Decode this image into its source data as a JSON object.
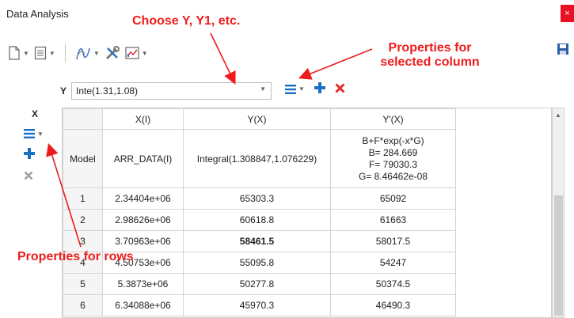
{
  "window": {
    "title": "Data Analysis",
    "close_glyph": "×"
  },
  "toolbar": {
    "buttons": [
      {
        "icon": "new-document-icon"
      },
      {
        "icon": "sheet-icon"
      },
      {
        "icon": "fit-curve-icon"
      },
      {
        "icon": "tools-icon"
      },
      {
        "icon": "chart-icon"
      }
    ],
    "save_icon": "save-icon"
  },
  "annotations": {
    "choose": "Choose Y, Y1, etc.",
    "props_column_line1": "Properties for",
    "props_column_line2": "selected column",
    "props_rows": "Properties for rows"
  },
  "y_selector": {
    "label": "Y",
    "value": "Inte(1.31,1.08)"
  },
  "x_label": "X",
  "table": {
    "columns": [
      "",
      "X(I)",
      "Y(X)",
      "Y'(X)"
    ],
    "model_row": {
      "label": "Model",
      "x": "ARR_DATA(I)",
      "y": "Integral(1.308847,1.076229)",
      "formula": [
        "B+F*exp(-x*G)",
        "B= 284.669",
        "F= 79030.3",
        "G= 8.46462e-08"
      ]
    },
    "rows": [
      {
        "n": "1",
        "x": "2.34404e+06",
        "y": "65303.3",
        "yp": "65092"
      },
      {
        "n": "2",
        "x": "2.98626e+06",
        "y": "60618.8",
        "yp": "61663"
      },
      {
        "n": "3",
        "x": "3.70963e+06",
        "y": "58461.5",
        "yp": "58017.5"
      },
      {
        "n": "4",
        "x": "4.50753e+06",
        "y": "55095.8",
        "yp": "54247"
      },
      {
        "n": "5",
        "x": "5.3873e+06",
        "y": "50277.8",
        "yp": "50374.5"
      },
      {
        "n": "6",
        "x": "6.34088e+06",
        "y": "45970.3",
        "yp": "46490.3"
      }
    ]
  },
  "colors": {
    "annotation": "#ee1c1c",
    "accent_blue": "#1a6fc4",
    "delete_red": "#e0302a"
  }
}
